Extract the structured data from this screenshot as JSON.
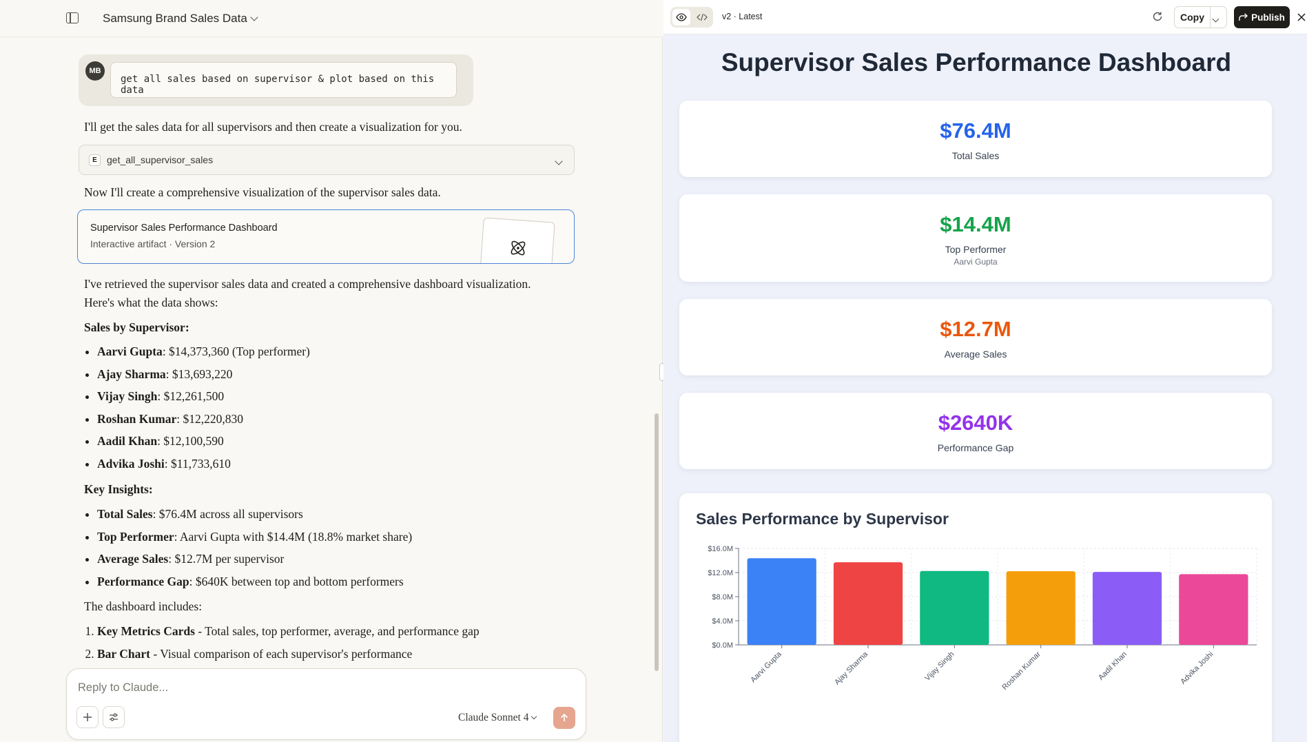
{
  "topbar": {
    "title": "Samsung Brand Sales Data"
  },
  "user_message": {
    "avatar": "MB",
    "text": "get all sales based on supervisor & plot based on this data"
  },
  "assistant": {
    "intro": "I'll get the sales data for all supervisors and then create a visualization for you.",
    "tool_call": {
      "icon": "E",
      "name": "get_all_supervisor_sales"
    },
    "after_tool": "Now I'll create a comprehensive visualization of the supervisor sales data.",
    "artifact": {
      "title": "Supervisor Sales Performance Dashboard",
      "meta": "Interactive artifact  ·  Version 2"
    },
    "summary_line1": "I've retrieved the supervisor sales data and created a comprehensive dashboard visualization.",
    "summary_line2": "Here's what the data shows:",
    "sales_heading": "Sales by Supervisor:",
    "sales": [
      {
        "name": "Aarvi Gupta",
        "value": ": $14,373,360 (Top performer)"
      },
      {
        "name": "Ajay Sharma",
        "value": ": $13,693,220"
      },
      {
        "name": "Vijay Singh",
        "value": ": $12,261,500"
      },
      {
        "name": "Roshan Kumar",
        "value": ": $12,220,830"
      },
      {
        "name": "Aadil Khan",
        "value": ": $12,100,590"
      },
      {
        "name": "Advika Joshi",
        "value": ": $11,733,610"
      }
    ],
    "insights_heading": "Key Insights:",
    "insights": [
      {
        "name": "Total Sales",
        "value": ": $76.4M across all supervisors"
      },
      {
        "name": "Top Performer",
        "value": ": Aarvi Gupta with $14.4M (18.8% market share)"
      },
      {
        "name": "Average Sales",
        "value": ": $12.7M per supervisor"
      },
      {
        "name": "Performance Gap",
        "value": ": $640K between top and bottom performers"
      }
    ],
    "includes_heading": "The dashboard includes:",
    "includes": [
      {
        "name": "Key Metrics Cards",
        "value": " - Total sales, top performer, average, and performance gap"
      },
      {
        "name": "Bar Chart",
        "value": " - Visual comparison of each supervisor's performance"
      }
    ]
  },
  "composer": {
    "placeholder": "Reply to Claude...",
    "model": "Claude Sonnet 4"
  },
  "artifact_bar": {
    "version": "v2 · Latest",
    "copy": "Copy",
    "publish": "Publish"
  },
  "dashboard": {
    "title": "Supervisor Sales Performance Dashboard",
    "metrics": [
      {
        "value": "$76.4M",
        "label": "Total Sales",
        "sub": "",
        "color": "#2563eb"
      },
      {
        "value": "$14.4M",
        "label": "Top Performer",
        "sub": "Aarvi Gupta",
        "color": "#16a34a"
      },
      {
        "value": "$12.7M",
        "label": "Average Sales",
        "sub": "",
        "color": "#ea580c"
      },
      {
        "value": "$2640K",
        "label": "Performance Gap",
        "sub": "",
        "color": "#9333ea"
      }
    ]
  },
  "chart_data": {
    "type": "bar",
    "title": "Sales Performance by Supervisor",
    "categories": [
      "Aarvi Gupta",
      "Ajay Sharma",
      "Vijay Singh",
      "Roshan Kumar",
      "Aadil Khan",
      "Advika Joshi"
    ],
    "values": [
      14373360,
      13693220,
      12261500,
      12220830,
      12100590,
      11733610
    ],
    "colors": [
      "#3b82f6",
      "#ef4444",
      "#10b981",
      "#f59e0b",
      "#8b5cf6",
      "#ec4899"
    ],
    "yticks": [
      "$0.0M",
      "$4.0M",
      "$8.0M",
      "$12.0M",
      "$16.0M"
    ],
    "ylim": [
      0,
      16000000
    ],
    "grid": true,
    "xlabel": "",
    "ylabel": ""
  }
}
